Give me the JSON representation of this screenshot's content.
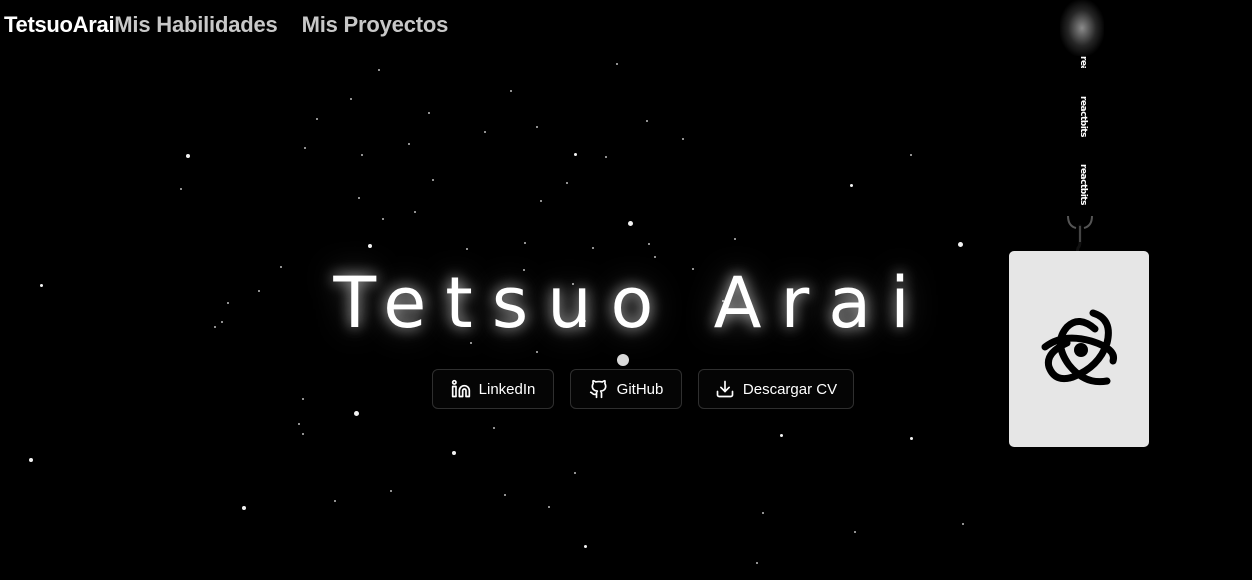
{
  "nav": {
    "brand": "TetsuoArai",
    "links": [
      {
        "label": "Mis Habilidades"
      },
      {
        "label": "Mis Proyectos"
      }
    ]
  },
  "hero": {
    "title": "Tetsuo Arai"
  },
  "buttons": {
    "linkedin": {
      "label": "LinkedIn",
      "icon": "linkedin-icon"
    },
    "github": {
      "label": "GitHub",
      "icon": "github-icon"
    },
    "cv": {
      "label": "Descargar CV",
      "icon": "download-icon"
    }
  },
  "badge": {
    "strap_text": "reactbits",
    "card_icon": "atom-logo-icon"
  },
  "colors": {
    "background": "#000000",
    "text": "#ffffff",
    "nav_link": "#c8c8c8",
    "card": "#e6e6e6",
    "button_border": "#2f2f2f"
  }
}
